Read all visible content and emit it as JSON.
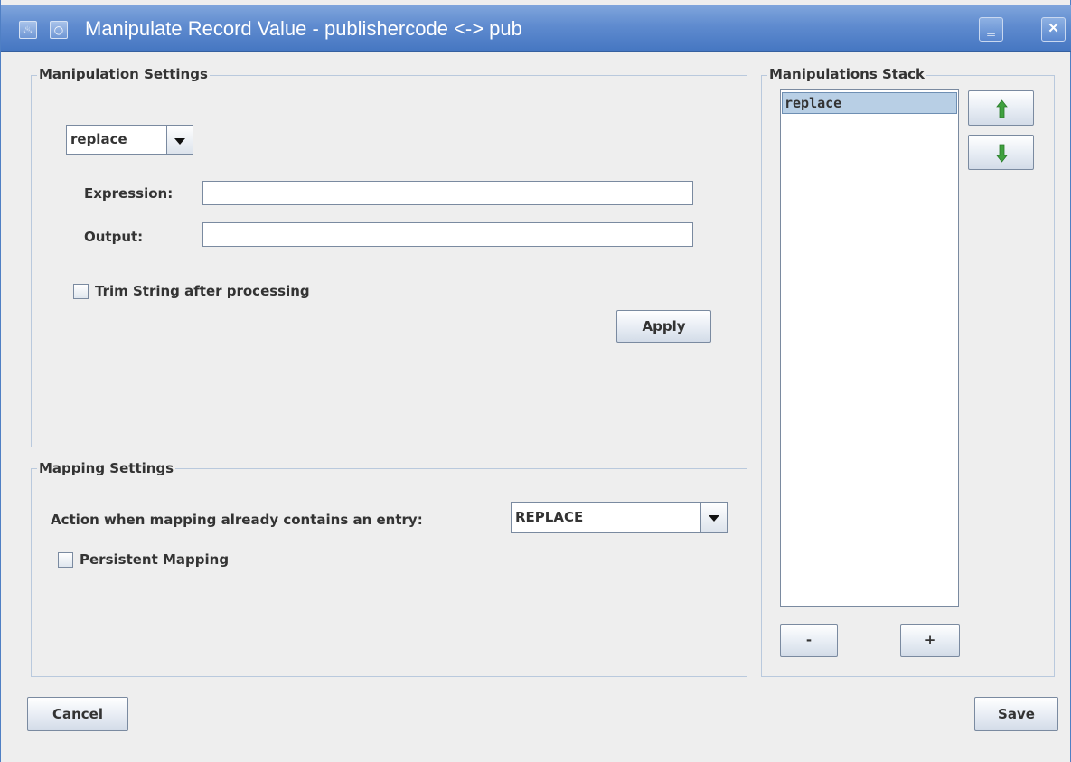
{
  "window": {
    "title": "Manipulate Record Value - publishercode <-> pub",
    "minimize_glyph": "‗",
    "close_glyph": "✕",
    "app_icon": "java-cup-icon",
    "menu_icon": "window-menu-icon"
  },
  "manipulation_settings": {
    "legend": "Manipulation Settings",
    "operation_value": "replace",
    "expression_label": "Expression:",
    "expression_value": "",
    "output_label": "Output:",
    "output_value": "",
    "trim_label": "Trim String after processing",
    "trim_checked": false,
    "apply_label": "Apply"
  },
  "mapping_settings": {
    "legend": "Mapping Settings",
    "action_label": "Action when mapping already contains an entry:",
    "action_value": "REPLACE",
    "persistent_label": "Persistent Mapping",
    "persistent_checked": false
  },
  "manipulations_stack": {
    "legend": "Manipulations Stack",
    "items": [
      "replace"
    ],
    "selected_index": 0,
    "up_icon": "arrow-up-icon",
    "down_icon": "arrow-down-icon",
    "remove_label": "-",
    "add_label": "+"
  },
  "footer": {
    "cancel_label": "Cancel",
    "save_label": "Save"
  },
  "colors": {
    "titlebar": "#5f8bcf",
    "selection": "#b8cfe5",
    "arrow_green": "#3fa13f"
  }
}
